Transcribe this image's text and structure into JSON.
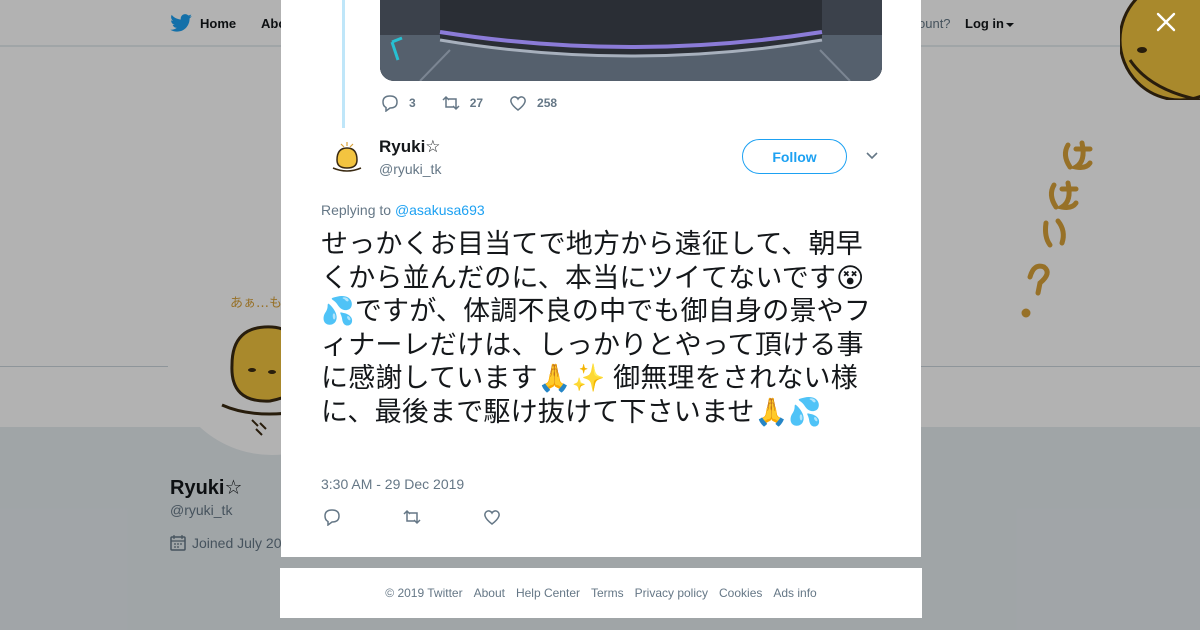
{
  "nav": {
    "home": "Home",
    "about": "Abo",
    "account_prompt": "ccount?",
    "login": "Log in"
  },
  "profile": {
    "name": "Ryuki☆",
    "handle": "@ryuki_tk",
    "joined": "Joined July 20",
    "handwriting": "はいはい？",
    "avatar_caption": "あぁ…も"
  },
  "tweet": {
    "parent_stats": {
      "replies": "3",
      "retweets": "27",
      "likes": "258"
    },
    "author_name": "Ryuki☆",
    "author_handle": "@ryuki_tk",
    "follow_label": "Follow",
    "replying_prefix": "Replying to",
    "replying_to": "@asakusa693",
    "text": "せっかくお目当てで地方から遠征して、朝早くから並んだのに、本当にツイてないです😵💦ですが、体調不良の中でも御自身の景やフィナーレだけは、しっかりとやって頂ける事に感謝しています🙏✨ 御無理をされない様に、最後まで駆け抜けて下さいませ🙏💦",
    "timestamp": "3:30 AM - 29 Dec 2019"
  },
  "footer": {
    "links": [
      "© 2019 Twitter",
      "About",
      "Help Center",
      "Terms",
      "Privacy policy",
      "Cookies",
      "Ads info"
    ]
  },
  "colors": {
    "brand_blue": "#1da1f2",
    "thread_line": "#bfe6f9",
    "muted_text": "#657786"
  },
  "icons": [
    "twitter-bird-icon",
    "caret-down-icon",
    "close-icon",
    "reply-icon",
    "retweet-icon",
    "like-icon",
    "calendar-icon",
    "chevron-down-icon"
  ]
}
